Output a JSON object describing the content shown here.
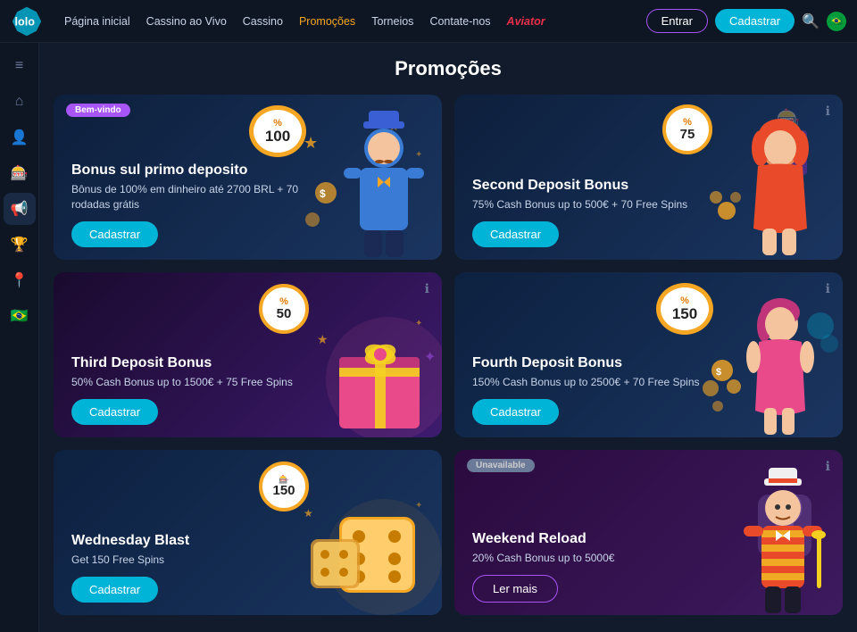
{
  "meta": {
    "site_name": "lolobet"
  },
  "topnav": {
    "links": [
      {
        "label": "Página inicial",
        "active": false,
        "key": "home"
      },
      {
        "label": "Cassino ao Vivo",
        "active": false,
        "key": "live"
      },
      {
        "label": "Cassino",
        "active": false,
        "key": "casino"
      },
      {
        "label": "Promoções",
        "active": true,
        "key": "promos"
      },
      {
        "label": "Torneios",
        "active": false,
        "key": "torneos"
      },
      {
        "label": "Contate-nos",
        "active": false,
        "key": "contact"
      },
      {
        "label": "Aviator",
        "active": false,
        "key": "aviator",
        "special": "aviator"
      }
    ],
    "btn_entrar": "Entrar",
    "btn_cadastrar": "Cadastrar"
  },
  "sidebar": {
    "icons": [
      {
        "name": "menu-icon",
        "symbol": "≡",
        "active": false
      },
      {
        "name": "home-icon",
        "symbol": "⌂",
        "active": false
      },
      {
        "name": "person-icon",
        "symbol": "👤",
        "active": false
      },
      {
        "name": "casino-chip-icon",
        "symbol": "🎰",
        "active": false
      },
      {
        "name": "megaphone-icon",
        "symbol": "📢",
        "active": true
      },
      {
        "name": "trophy-icon",
        "symbol": "🏆",
        "active": false
      },
      {
        "name": "location-icon",
        "symbol": "📍",
        "active": false
      },
      {
        "name": "brazil-flag-icon",
        "symbol": "🇧🇷",
        "active": false
      }
    ]
  },
  "page": {
    "title": "Promoções"
  },
  "promotions": [
    {
      "id": "first-deposit",
      "badge": "Bem-vindo",
      "badge_type": "welcome",
      "title": "Bonus sul primo deposito",
      "desc": "Bônus de 100% em dinheiro até 2700 BRL + 70 rodadas grátis",
      "percent": "100",
      "btn_label": "Cadastrar",
      "btn_type": "cadastrar",
      "art": "man",
      "card_style": "first"
    },
    {
      "id": "second-deposit",
      "badge": null,
      "badge_type": null,
      "title": "Second Deposit Bonus",
      "desc": "75% Cash Bonus up to 500€ + 70 Free Spins",
      "percent": "75",
      "btn_label": "Cadastrar",
      "btn_type": "cadastrar",
      "art": "woman1",
      "card_style": "second"
    },
    {
      "id": "third-deposit",
      "badge": null,
      "badge_type": null,
      "title": "Third Deposit Bonus",
      "desc": "50% Cash Bonus up to 1500€ + 75 Free Spins",
      "percent": "50",
      "btn_label": "Cadastrar",
      "btn_type": "cadastrar",
      "art": "gift",
      "card_style": "third"
    },
    {
      "id": "fourth-deposit",
      "badge": null,
      "badge_type": null,
      "title": "Fourth Deposit Bonus",
      "desc": "150% Cash Bonus up to 2500€ + 70 Free Spins",
      "percent": "150",
      "btn_label": "Cadastrar",
      "btn_type": "cadastrar",
      "art": "woman2",
      "card_style": "fourth"
    },
    {
      "id": "wednesday",
      "badge": null,
      "badge_type": null,
      "title": "Wednesday Blast",
      "desc": "Get 150 Free Spins",
      "percent": "150",
      "btn_label": "Cadastrar",
      "btn_type": "cadastrar",
      "art": "dice",
      "card_style": "wednesday"
    },
    {
      "id": "weekend",
      "badge": "Unavailable",
      "badge_type": "unavailable",
      "title": "Weekend Reload",
      "desc": "20% Cash Bonus up to 5000€",
      "percent": null,
      "btn_label": "Ler mais",
      "btn_type": "ler-mais",
      "art": "man2",
      "card_style": "weekend"
    }
  ]
}
